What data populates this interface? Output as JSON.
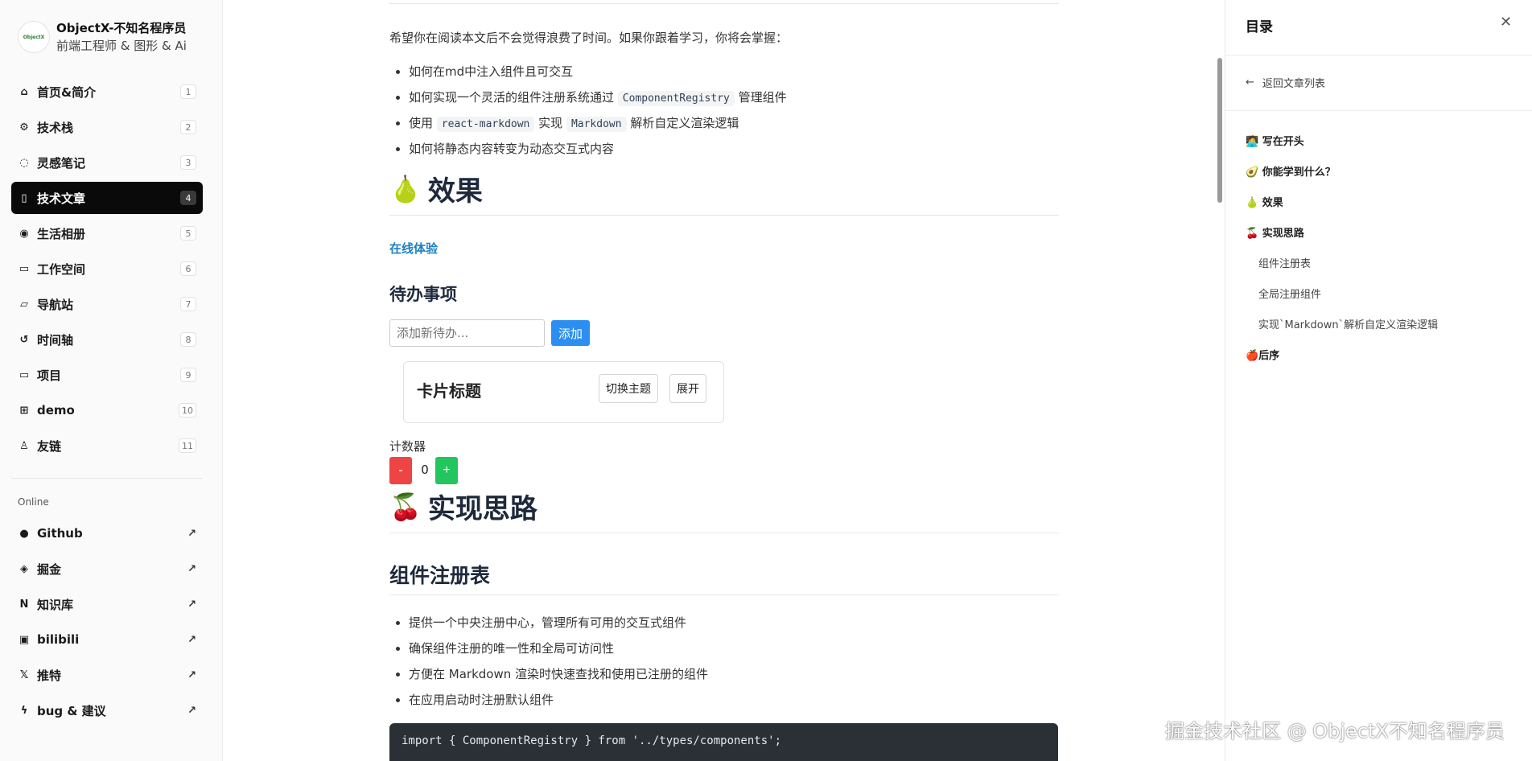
{
  "profile": {
    "avatar_text": "ObjectX",
    "name": "ObjectX-不知名程序员",
    "subtitle": "前端工程师 & 图形 & Ai"
  },
  "nav": {
    "items": [
      {
        "label": "首页&简介",
        "badge": "1",
        "icon": "home-icon"
      },
      {
        "label": "技术栈",
        "badge": "2",
        "icon": "cpu-icon"
      },
      {
        "label": "灵感笔记",
        "badge": "3",
        "icon": "lightbulb-icon"
      },
      {
        "label": "技术文章",
        "badge": "4",
        "icon": "book-icon"
      },
      {
        "label": "生活相册",
        "badge": "5",
        "icon": "camera-icon"
      },
      {
        "label": "工作空间",
        "badge": "6",
        "icon": "laptop-icon"
      },
      {
        "label": "导航站",
        "badge": "7",
        "icon": "folder-search-icon"
      },
      {
        "label": "时间轴",
        "badge": "8",
        "icon": "history-icon"
      },
      {
        "label": "项目",
        "badge": "9",
        "icon": "folder-icon"
      },
      {
        "label": "demo",
        "badge": "10",
        "icon": "grid-plus-icon"
      },
      {
        "label": "友链",
        "badge": "11",
        "icon": "users-icon"
      }
    ],
    "active_index": 3
  },
  "online": {
    "title": "Online",
    "items": [
      {
        "label": "Github",
        "icon": "github-icon"
      },
      {
        "label": "掘金",
        "icon": "juejin-icon"
      },
      {
        "label": "知识库",
        "icon": "notion-icon"
      },
      {
        "label": "bilibili",
        "icon": "bilibili-icon"
      },
      {
        "label": "推特",
        "icon": "x-twitter-icon"
      },
      {
        "label": "bug & 建议",
        "icon": "bug-icon"
      }
    ]
  },
  "article": {
    "intro": "希望你在阅读本文后不会觉得浪费了时间。如果你跟着学习，你将会掌握：",
    "learn_1": "如何在md中注入组件且可交互",
    "learn_2_pre": "如何实现一个灵活的组件注册系统通过",
    "learn_2_code": "ComponentRegistry",
    "learn_2_post": "管理组件",
    "learn_3_pre": "使用",
    "learn_3_code1": "react-markdown",
    "learn_3_mid": "实现",
    "learn_3_code2": "Markdown",
    "learn_3_post": "解析自定义渲染逻辑",
    "learn_4": "如何将静态内容转变为动态交互式内容",
    "h_effect_emoji": "🍐",
    "h_effect": "效果",
    "online_link": "在线体验",
    "todo_title": "待办事项",
    "todo_placeholder": "添加新待办...",
    "todo_add": "添加",
    "card_title": "卡片标题",
    "card_btn_theme": "切换主题",
    "card_btn_expand": "展开",
    "counter_label": "计数器",
    "counter_minus": "-",
    "counter_value": "0",
    "counter_plus": "+",
    "h_idea_emoji": "🍒",
    "h_idea": "实现思路",
    "h_registry": "组件注册表",
    "reg_1": "提供一个中央注册中心，管理所有可用的交互式组件",
    "reg_2": "确保组件注册的唯一性和全局可访问性",
    "reg_3": "方便在 Markdown 渲染时快速查找和使用已注册的组件",
    "reg_4": "在应用启动时注册默认组件",
    "code_line": "import { ComponentRegistry } from '../types/components';"
  },
  "toc": {
    "title": "目录",
    "close": "✕",
    "back": "返回文章列表",
    "items": [
      {
        "label": "🧑‍💻 写在开头",
        "level": 1
      },
      {
        "label": "🥑 你能学到什么？",
        "level": 1
      },
      {
        "label": "🍐 效果",
        "level": 1
      },
      {
        "label": "🍒 实现思路",
        "level": 1
      },
      {
        "label": "组件注册表",
        "level": 2
      },
      {
        "label": "全局注册组件",
        "level": 2
      },
      {
        "label": "实现`Markdown`解析自定义渲染逻辑",
        "level": 2
      },
      {
        "label": "🍎后序",
        "level": 1
      }
    ]
  },
  "watermark": "掘金技术社区 @ ObjectX不知名程序员"
}
